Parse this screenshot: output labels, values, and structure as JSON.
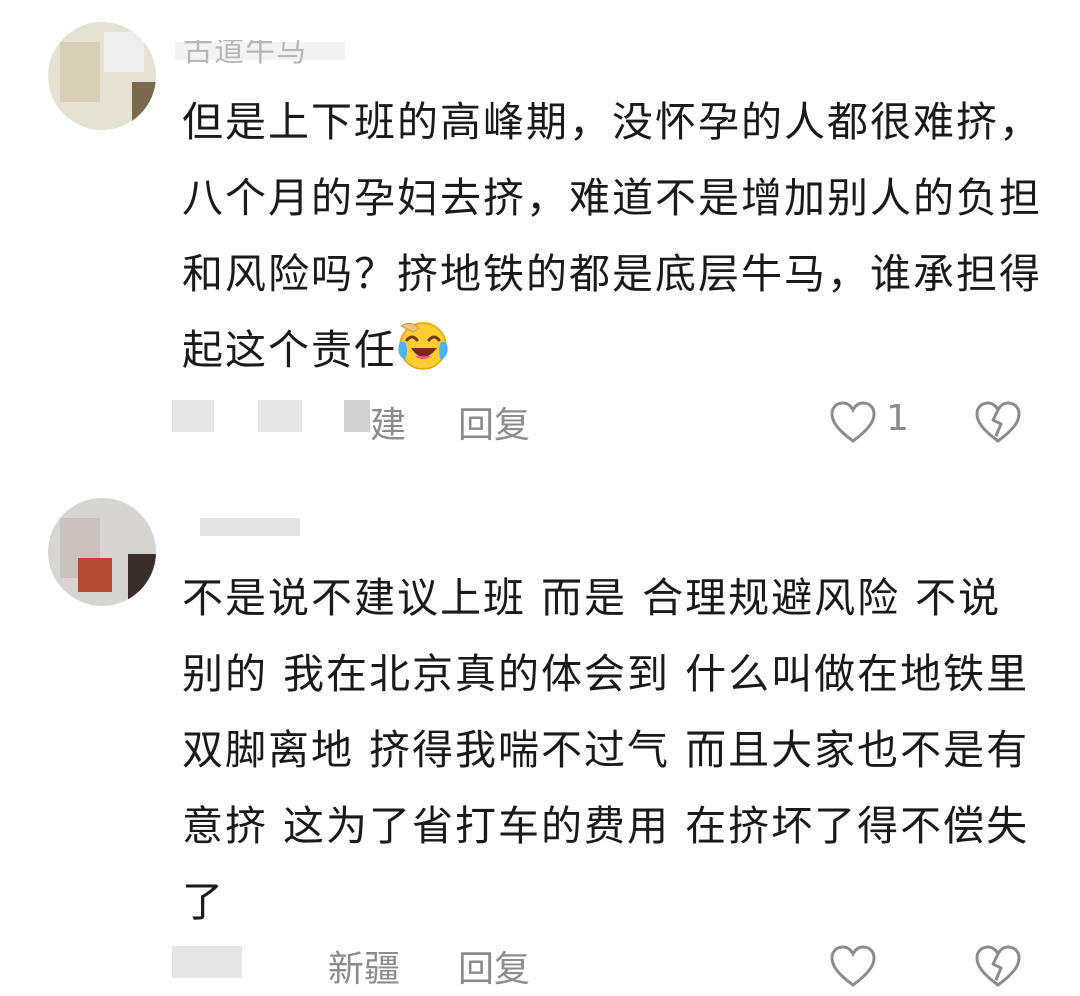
{
  "comments": [
    {
      "username": "古道牛马",
      "text": "但是上下班的高峰期，没怀孕的人都很难挤，八个月的孕妇去挤，难道不是增加别人的负担和风险吗？挤地铁的都是底层牛马，谁承担得起这个责任",
      "emoji": "laughing-crying-emoji",
      "location": "建",
      "reply_label": "回复",
      "like_count": "1"
    },
    {
      "username": "",
      "text": "不是说不建议上班 而是 合理规避风险 不说别的 我在北京真的体会到 什么叫做在地铁里双脚离地 挤得我喘不过气 而且大家也不是有意挤 这为了省打车的费用 在挤坏了得不偿失了",
      "location": "新疆",
      "reply_label": "回复",
      "like_count": ""
    }
  ],
  "colors": {
    "text": "#1a1a1a",
    "meta": "#8c8c8c",
    "background": "#ffffff"
  }
}
